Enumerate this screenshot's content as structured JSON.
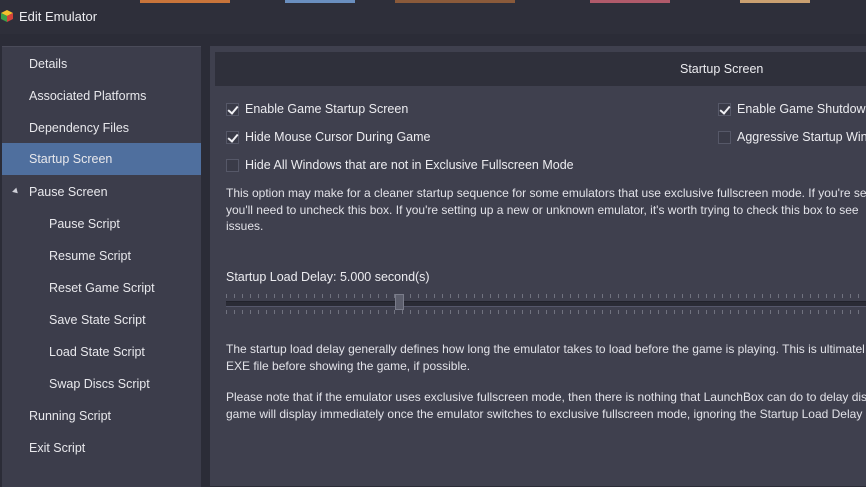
{
  "window": {
    "title": "Edit Emulator",
    "icon": "launchbox-cube-icon"
  },
  "sidebar": {
    "items": [
      {
        "label": "Details",
        "level": 0,
        "selected": false
      },
      {
        "label": "Associated Platforms",
        "level": 0,
        "selected": false
      },
      {
        "label": "Dependency Files",
        "level": 0,
        "selected": false
      },
      {
        "label": "Startup Screen",
        "level": 0,
        "selected": true
      },
      {
        "label": "Pause Screen",
        "level": 0,
        "selected": false,
        "expanded": true
      },
      {
        "label": "Pause Script",
        "level": 1,
        "selected": false
      },
      {
        "label": "Resume Script",
        "level": 1,
        "selected": false
      },
      {
        "label": "Reset Game Script",
        "level": 1,
        "selected": false
      },
      {
        "label": "Save State Script",
        "level": 1,
        "selected": false
      },
      {
        "label": "Load State Script",
        "level": 1,
        "selected": false
      },
      {
        "label": "Swap Discs Script",
        "level": 1,
        "selected": false
      },
      {
        "label": "Running Script",
        "level": 0,
        "selected": false
      },
      {
        "label": "Exit Script",
        "level": 0,
        "selected": false
      }
    ]
  },
  "main": {
    "header": "Startup Screen",
    "options": {
      "enable_startup": {
        "label": "Enable Game Startup Screen",
        "checked": true
      },
      "enable_shutdown": {
        "label": "Enable Game Shutdown",
        "checked": true
      },
      "hide_cursor": {
        "label": "Hide Mouse Cursor During Game",
        "checked": true
      },
      "aggressive": {
        "label": "Aggressive Startup Wind",
        "checked": false
      },
      "hide_windows": {
        "label": "Hide All Windows that are not in Exclusive Fullscreen Mode",
        "checked": false
      }
    },
    "info_text": [
      "This option may make for a cleaner startup sequence for some emulators that use exclusive fullscreen mode. If you're see",
      "you'll need to uncheck this box. If you're setting up a new or unknown emulator, it's worth trying to check this box to see",
      "issues."
    ],
    "delay_label": "Startup Load Delay: 5.000 second(s)",
    "delay_slider": {
      "value_fraction": 0.26
    },
    "delay_text": [
      "The startup load delay generally defines how long the emulator takes to load before the game is playing. This is ultimatel",
      "EXE file before showing the game, if possible."
    ],
    "note_text": [
      "Please note that if the emulator uses exclusive fullscreen mode, then there is nothing that LaunchBox can do to delay disp",
      "game will display immediately once the emulator switches to exclusive fullscreen mode, ignoring the Startup Load Delay s"
    ]
  },
  "colors": {
    "selected": "#4f6f9e",
    "sidebar_bg": "#3c3d4b",
    "panel_bg": "#3f404e",
    "header_bg": "#2f303b"
  }
}
